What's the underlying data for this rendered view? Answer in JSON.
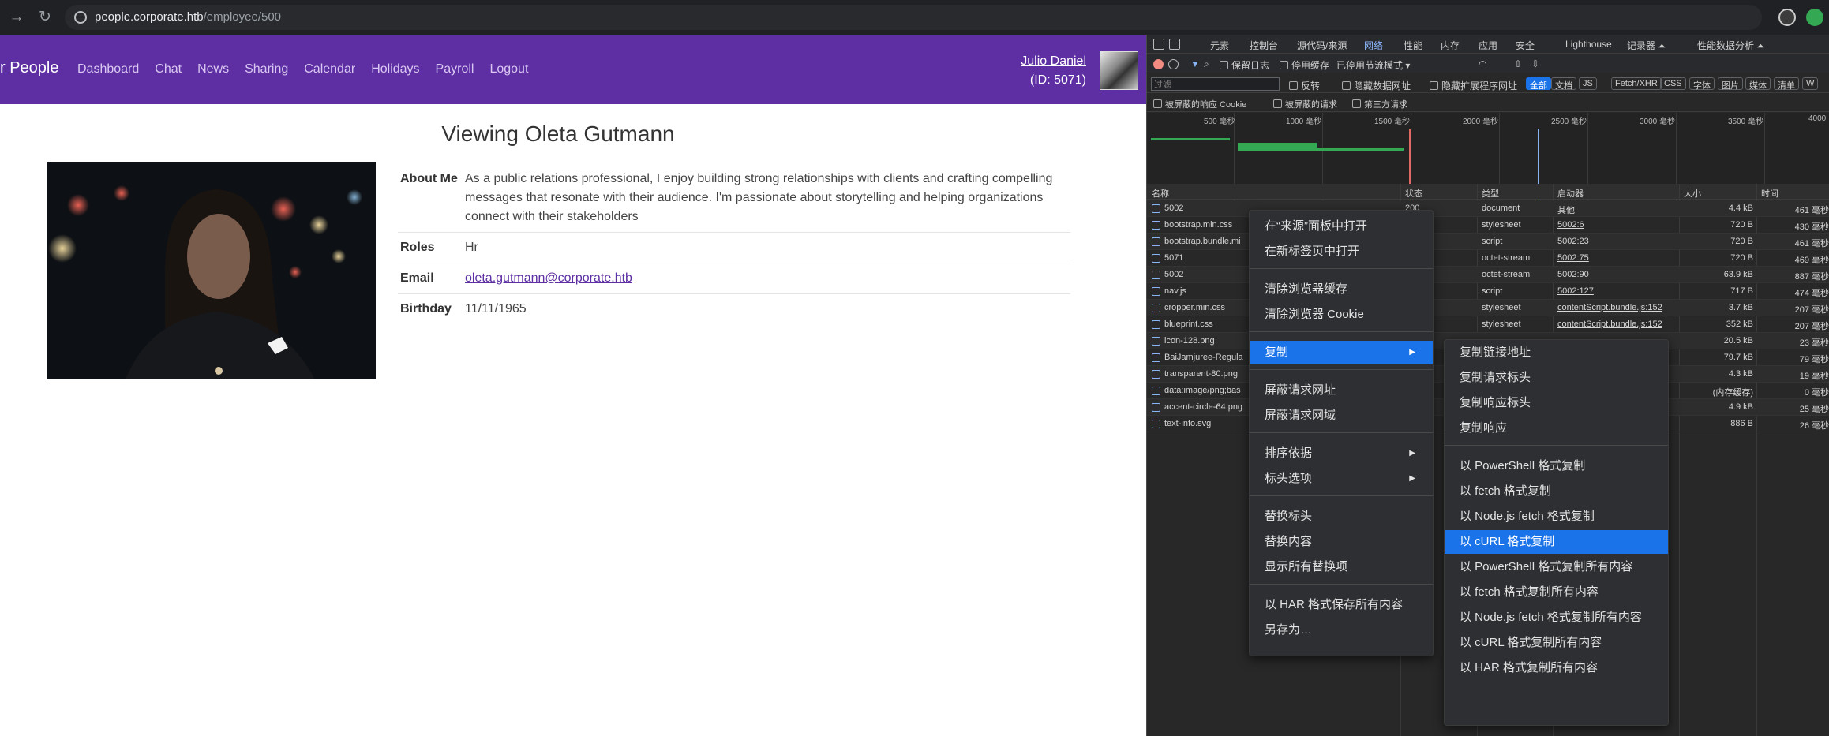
{
  "browser": {
    "url_host": "people.corporate.htb",
    "url_path": "/employee/500"
  },
  "site": {
    "brand": "r People",
    "nav": [
      "Dashboard",
      "Chat",
      "News",
      "Sharing",
      "Calendar",
      "Holidays",
      "Payroll",
      "Logout"
    ],
    "user_name": "Julio Daniel",
    "user_id": "(ID: 5071)"
  },
  "profile": {
    "heading": "Viewing Oleta Gutmann",
    "rows": [
      {
        "label": "About Me",
        "value": "As a public relations professional, I enjoy building strong relationships with clients and crafting compelling messages that resonate with their audience. I'm passionate about storytelling and helping organizations connect with their stakeholders"
      },
      {
        "label": "Roles",
        "value": "Hr"
      },
      {
        "label": "Email",
        "value": "oleta.gutmann@corporate.htb"
      },
      {
        "label": "Birthday",
        "value": "11/11/1965"
      }
    ]
  },
  "devtools": {
    "tabs": [
      "元素",
      "控制台",
      "源代码/来源",
      "网络",
      "性能",
      "内存",
      "应用",
      "安全",
      "Lighthouse",
      "记录器 ⏶",
      "性能数据分析 ⏶"
    ],
    "active_tab": "网络",
    "toolbar": {
      "preserve_log": "保留日志",
      "disable_cache": "停用缓存",
      "throttle": "已停用节流模式"
    },
    "filter": {
      "placeholder": "过滤",
      "invert": "反转",
      "hide_data": "隐藏数据网址",
      "hide_ext": "隐藏扩展程序网址",
      "chips": [
        "全部",
        "文档",
        "JS",
        "Fetch/XHR",
        "CSS",
        "字体",
        "图片",
        "媒体",
        "清单",
        "W"
      ]
    },
    "cookie_filters": [
      "被屏蔽的响应 Cookie",
      "被屏蔽的请求",
      "第三方请求"
    ],
    "overview_ticks": [
      "500 毫秒",
      "1000 毫秒",
      "1500 毫秒",
      "2000 毫秒",
      "2500 毫秒",
      "3000 毫秒",
      "3500 毫秒",
      "4000"
    ],
    "columns": [
      "名称",
      "状态",
      "类型",
      "启动器",
      "大小",
      "时间"
    ],
    "requests": [
      {
        "name": "5002",
        "status": "200",
        "type": "document",
        "initiator": "其他",
        "size": "4.4 kB",
        "time": "461 毫秒"
      },
      {
        "name": "bootstrap.min.css",
        "status": "",
        "type": "stylesheet",
        "initiator": "5002:6",
        "size": "720 B",
        "time": "430 毫秒"
      },
      {
        "name": "bootstrap.bundle.mi",
        "status": "",
        "type": "script",
        "initiator": "5002:23",
        "size": "720 B",
        "time": "461 毫秒"
      },
      {
        "name": "5071",
        "status": "",
        "type": "octet-stream",
        "initiator": "5002:75",
        "size": "720 B",
        "time": "469 毫秒"
      },
      {
        "name": "5002",
        "status": "",
        "type": "octet-stream",
        "initiator": "5002:90",
        "size": "63.9 kB",
        "time": "887 毫秒"
      },
      {
        "name": "nav.js",
        "status": "",
        "type": "script",
        "initiator": "5002:127",
        "size": "717 B",
        "time": "474 毫秒"
      },
      {
        "name": "cropper.min.css",
        "status": "",
        "type": "stylesheet",
        "initiator": "contentScript.bundle.js:152",
        "size": "3.7 kB",
        "time": "207 毫秒"
      },
      {
        "name": "blueprint.css",
        "status": "",
        "type": "stylesheet",
        "initiator": "contentScript.bundle.js:152",
        "size": "352 kB",
        "time": "207 毫秒"
      },
      {
        "name": "icon-128.png",
        "status": "",
        "type": "",
        "initiator": "",
        "size": "20.5 kB",
        "time": "23 毫秒"
      },
      {
        "name": "BaiJamjuree-Regula",
        "status": "",
        "type": "",
        "initiator": "",
        "size": "79.7 kB",
        "time": "79 毫秒"
      },
      {
        "name": "transparent-80.png",
        "status": "",
        "type": "",
        "initiator": "2",
        "size": "4.3 kB",
        "time": "19 毫秒"
      },
      {
        "name": "data:image/png;bas",
        "status": "",
        "type": "",
        "initiator": "2",
        "size": "(内存缓存)",
        "time": "0 毫秒"
      },
      {
        "name": "accent-circle-64.png",
        "status": "",
        "type": "",
        "initiator": "2",
        "size": "4.9 kB",
        "time": "25 毫秒"
      },
      {
        "name": "text-info.svg",
        "status": "",
        "type": "",
        "initiator": "",
        "size": "886 B",
        "time": "26 毫秒"
      }
    ]
  },
  "context_menu": {
    "items": [
      "在“来源”面板中打开",
      "在新标签页中打开",
      "清除浏览器缓存",
      "清除浏览器 Cookie",
      "复制",
      "屏蔽请求网址",
      "屏蔽请求网域",
      "排序依据",
      "标头选项",
      "替换标头",
      "替换内容",
      "显示所有替换项",
      "以 HAR 格式保存所有内容",
      "另存为…"
    ],
    "highlighted": "复制"
  },
  "copy_submenu": {
    "items": [
      "复制链接地址",
      "复制请求标头",
      "复制响应标头",
      "复制响应",
      "以 PowerShell 格式复制",
      "以 fetch 格式复制",
      "以 Node.js fetch 格式复制",
      "以 cURL 格式复制",
      "以 PowerShell 格式复制所有内容",
      "以 fetch 格式复制所有内容",
      "以 Node.js fetch 格式复制所有内容",
      "以 cURL 格式复制所有内容",
      "以 HAR 格式复制所有内容"
    ],
    "highlighted": "以 cURL 格式复制"
  },
  "colors": {
    "brand_purple": "#5e2ea3",
    "highlight_blue": "#1a73e8"
  }
}
